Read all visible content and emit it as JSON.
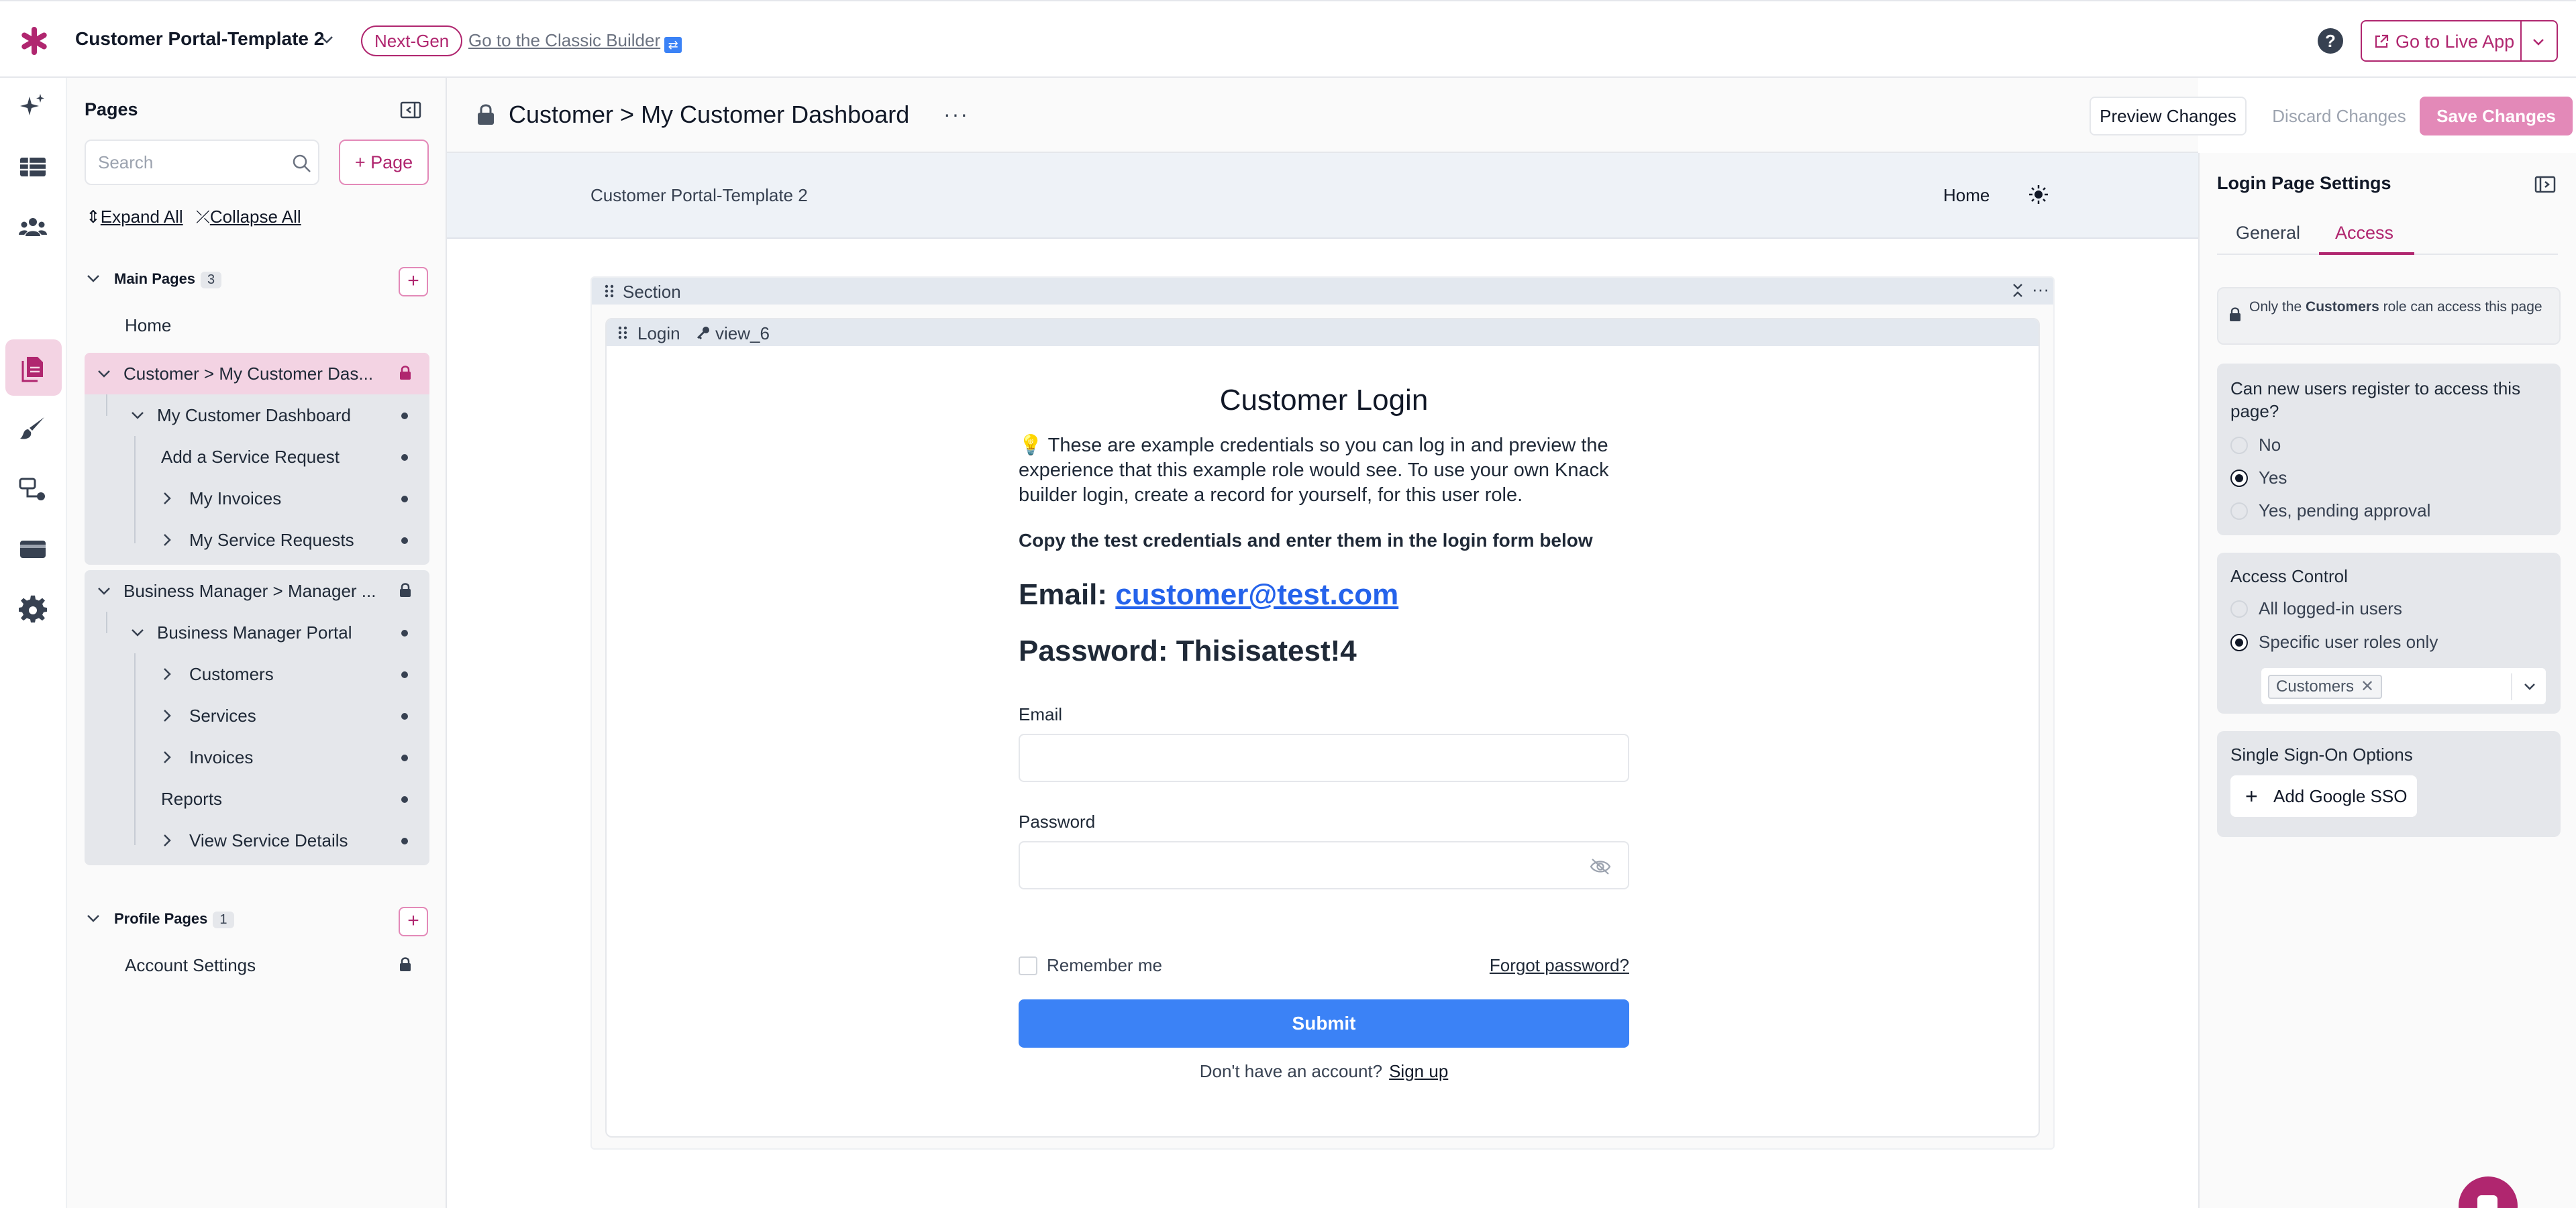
{
  "app": {
    "title": "Customer Portal-Template 2",
    "badge": "Next-Gen",
    "classic_link": "Go to the Classic Builder",
    "live_button": "Go to Live App",
    "help": "?"
  },
  "rail": {
    "icons": [
      "sparkle-icon",
      "table-icon",
      "users-icon",
      "pages-icon",
      "brush-icon",
      "flows-icon",
      "billing-icon",
      "settings-icon"
    ],
    "active": "pages-icon"
  },
  "pages_panel": {
    "title": "Pages",
    "search_placeholder": "Search",
    "add_page": "+ Page",
    "expand_all": "Expand All",
    "collapse_all": "Collapse All",
    "main_pages": {
      "label": "Main Pages",
      "count": "3",
      "home": "Home",
      "customer_block": [
        {
          "label": "Customer > My Customer Das...",
          "kind": "lock"
        },
        {
          "label": "My Customer Dashboard",
          "kind": "dot"
        },
        {
          "label": "Add a Service Request",
          "kind": "dot"
        },
        {
          "label": "My Invoices",
          "kind": "dot"
        },
        {
          "label": "My Service Requests",
          "kind": "dot"
        }
      ],
      "manager_block": [
        {
          "label": "Business Manager > Manager ...",
          "kind": "lock"
        },
        {
          "label": "Business Manager Portal",
          "kind": "dot"
        },
        {
          "label": "Customers",
          "kind": "dot"
        },
        {
          "label": "Services",
          "kind": "dot"
        },
        {
          "label": "Invoices",
          "kind": "dot"
        },
        {
          "label": "Reports",
          "kind": "dot"
        },
        {
          "label": "View Service Details",
          "kind": "dot"
        }
      ]
    },
    "profile_pages": {
      "label": "Profile Pages",
      "count": "1",
      "items": [
        "Account Settings"
      ]
    }
  },
  "header": {
    "title": "Customer > My Customer Dashboard",
    "more": "···",
    "preview": "Preview Changes",
    "discard": "Discard Changes",
    "save": "Save Changes"
  },
  "canvas": {
    "portal_name": "Customer Portal-Template 2",
    "nav_home": "Home",
    "section_label": "Section",
    "view_label": "Login",
    "view_id": "view_6",
    "login": {
      "title": "Customer Login",
      "description": "💡 These are example credentials so you can log in and preview the experience that this example role would see. To use your own Knack builder login, create a record for yourself, for this user role.",
      "copy_note": "Copy the test credentials and enter them in the login form below",
      "email_prefix": "Email: ",
      "email_value": "customer@test.com",
      "password_line": "Password: Thisisatest!4",
      "email_label": "Email",
      "password_label": "Password",
      "remember": "Remember me",
      "forgot": "Forgot password?",
      "submit": "Submit",
      "no_account": "Don't have an account?",
      "sign_up": "Sign up"
    }
  },
  "settings": {
    "title": "Login Page Settings",
    "tabs": [
      "General",
      "Access"
    ],
    "active_tab": "Access",
    "note_prefix": "Only the ",
    "note_role": "Customers",
    "note_suffix": " role can access this page",
    "register": {
      "question": "Can new users register to access this page?",
      "options": [
        "No",
        "Yes",
        "Yes, pending approval"
      ],
      "selected": "Yes"
    },
    "access": {
      "title": "Access Control",
      "options": [
        "All logged-in users",
        "Specific user roles only"
      ],
      "selected": "Specific user roles only",
      "roles": [
        "Customers"
      ]
    },
    "sso": {
      "title": "Single Sign-On Options",
      "button": "Add Google SSO"
    }
  },
  "colors": {
    "brand": "#b0266f",
    "brand_light": "#e389b8",
    "submit": "#3b82f6",
    "link": "#2563eb"
  }
}
